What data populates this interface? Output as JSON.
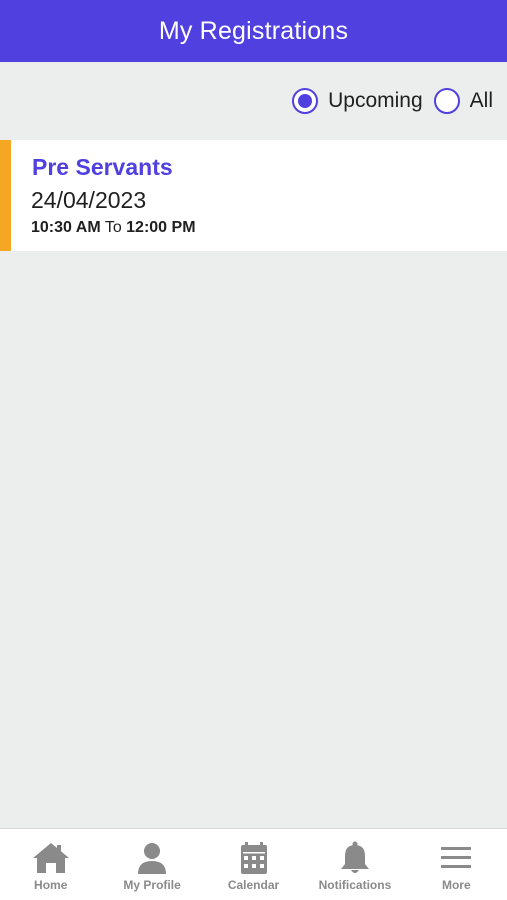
{
  "header": {
    "title": "My Registrations"
  },
  "filter": {
    "options": [
      {
        "label": "Upcoming",
        "selected": true
      },
      {
        "label": "All",
        "selected": false
      }
    ]
  },
  "registrations": [
    {
      "title": "Pre Servants",
      "date": "24/04/2023",
      "start_time": "10:30 AM",
      "separator": "To",
      "end_time": "12:00 PM"
    }
  ],
  "colors": {
    "primary": "#5040e0",
    "accent": "#f5a623",
    "background": "#eceeed",
    "tab_icon": "#8a8a8a"
  },
  "tabbar": {
    "items": [
      {
        "label": "Home",
        "icon": "home-icon"
      },
      {
        "label": "My Profile",
        "icon": "person-icon"
      },
      {
        "label": "Calendar",
        "icon": "calendar-icon"
      },
      {
        "label": "Notifications",
        "icon": "bell-icon"
      },
      {
        "label": "More",
        "icon": "menu-icon"
      }
    ]
  }
}
